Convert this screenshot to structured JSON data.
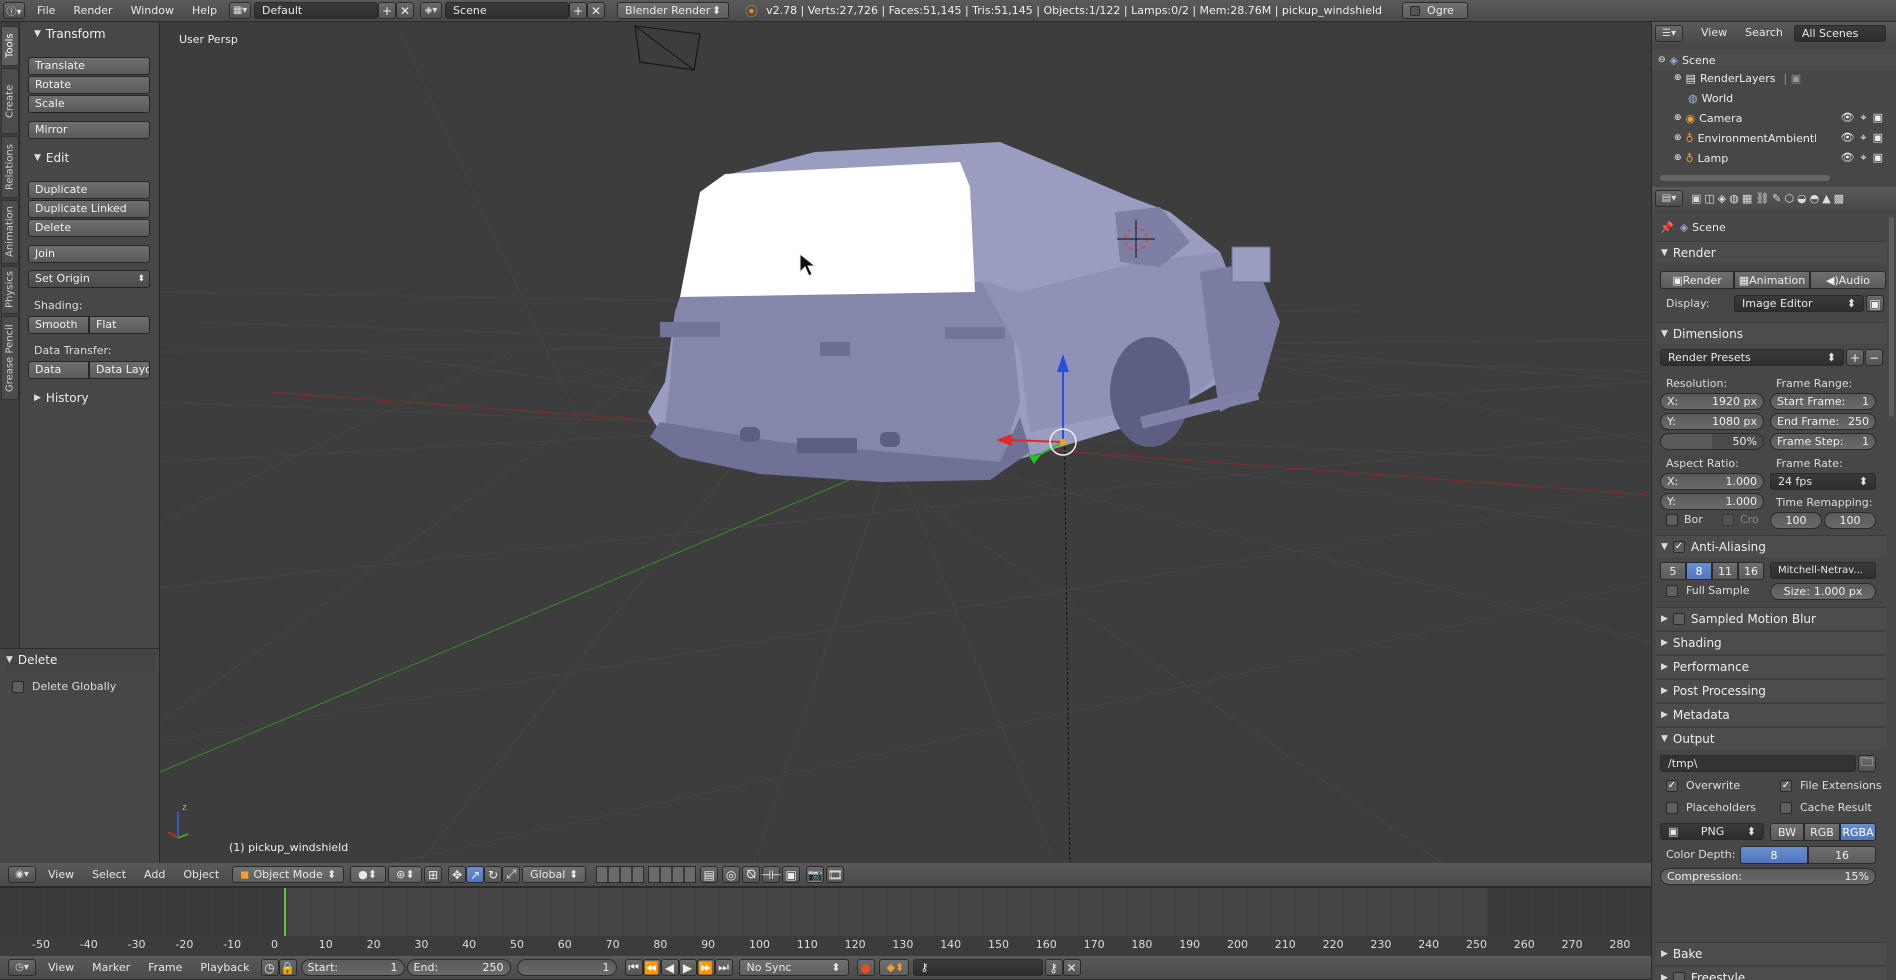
{
  "topbar": {
    "menus": [
      "File",
      "Render",
      "Window",
      "Help"
    ],
    "layout": "Default",
    "scene": "Scene",
    "engine": "Blender Render",
    "stats": "v2.78 | Verts:27,726 | Faces:51,145 | Tris:51,145 | Objects:1/122 | Lamps:0/2 | Mem:28.76M | pickup_windshield",
    "ogre": "Ogre"
  },
  "toolshelf": {
    "tabs": [
      "Tools",
      "Create",
      "Relations",
      "Animation",
      "Physics",
      "Grease Pencil"
    ],
    "transform": {
      "title": "Transform",
      "translate": "Translate",
      "rotate": "Rotate",
      "scale": "Scale",
      "mirror": "Mirror"
    },
    "edit": {
      "title": "Edit",
      "duplicate": "Duplicate",
      "duplicate_linked": "Duplicate Linked",
      "delete": "Delete",
      "join": "Join",
      "set_origin": "Set Origin",
      "shading_label": "Shading:",
      "smooth": "Smooth",
      "flat": "Flat",
      "data_transfer_label": "Data Transfer:",
      "data": "Data",
      "data_layout": "Data Layo"
    },
    "history": "History",
    "operator": {
      "title": "Delete",
      "delete_globally": "Delete Globally"
    }
  },
  "viewport": {
    "view_label": "User Persp",
    "object_label": "(1) pickup_windshield"
  },
  "outliner": {
    "buttons": [
      "View",
      "Search",
      "All Scenes"
    ],
    "items": [
      {
        "label": "Scene"
      },
      {
        "label": "RenderLayers"
      },
      {
        "label": "World"
      },
      {
        "label": "Camera"
      },
      {
        "label": "EnvironmentAmbientLi"
      },
      {
        "label": "Lamp"
      }
    ]
  },
  "properties": {
    "breadcrumb": "Scene",
    "render_section": "Render",
    "render_btn": "Render",
    "animation_btn": "Animation",
    "audio_btn": "Audio",
    "display_label": "Display:",
    "display_value": "Image Editor",
    "dimensions": "Dimensions",
    "render_presets": "Render Presets",
    "resolution_label": "Resolution:",
    "res_x_label": "X:",
    "res_x": "1920 px",
    "res_y_label": "Y:",
    "res_y": "1080 px",
    "res_pct": "50%",
    "frame_range_label": "Frame Range:",
    "start_frame_label": "Start Frame:",
    "start_frame": "1",
    "end_frame_label": "End Frame:",
    "end_frame": "250",
    "frame_step_label": "Frame Step:",
    "frame_step": "1",
    "aspect_label": "Aspect Ratio:",
    "aspect_x_label": "X:",
    "aspect_x": "1.000",
    "aspect_y_label": "Y:",
    "aspect_y": "1.000",
    "frame_rate_label": "Frame Rate:",
    "frame_rate": "24 fps",
    "time_remap_label": "Time Remapping:",
    "remap_old": "100",
    "remap_new": "100",
    "bor": "Bor",
    "cro": "Cro",
    "anti_aliasing": "Anti-Aliasing",
    "aa_samples": [
      "5",
      "8",
      "11",
      "16"
    ],
    "aa_filter": "Mitchell-Netrav...",
    "full_sample": "Full Sample",
    "aa_size_label": "Size:",
    "aa_size": "1.000 px",
    "sampled_motion_blur": "Sampled Motion Blur",
    "shading": "Shading",
    "performance": "Performance",
    "post_processing": "Post Processing",
    "metadata": "Metadata",
    "output": "Output",
    "output_path": "/tmp\\",
    "overwrite": "Overwrite",
    "file_extensions": "File Extensions",
    "placeholders": "Placeholders",
    "cache_result": "Cache Result",
    "file_format": "PNG",
    "color_modes": [
      "BW",
      "RGB",
      "RGBA"
    ],
    "color_depth_label": "Color Depth:",
    "color_depths": [
      "8",
      "16"
    ],
    "compression_label": "Compression:",
    "compression": "15%",
    "bake": "Bake",
    "freestyle": "Freestyle"
  },
  "viewheader": {
    "menus": [
      "View",
      "Select",
      "Add",
      "Object"
    ],
    "mode": "Object Mode",
    "orientation": "Global"
  },
  "timeline": {
    "ruler": [
      "-50",
      "-40",
      "-30",
      "-20",
      "-10",
      "0",
      "10",
      "20",
      "30",
      "40",
      "50",
      "60",
      "70",
      "80",
      "90",
      "100",
      "110",
      "120",
      "130",
      "140",
      "150",
      "160",
      "170",
      "180",
      "190",
      "200",
      "210",
      "220",
      "230",
      "240",
      "250",
      "260",
      "270",
      "280"
    ],
    "current_frame": "0"
  },
  "timeline_header": {
    "menus": [
      "View",
      "Marker",
      "Frame",
      "Playback"
    ],
    "start_label": "Start:",
    "start": "1",
    "end_label": "End:",
    "end": "250",
    "current": "1",
    "sync": "No Sync"
  },
  "colors": {
    "accent": "#5275bd",
    "selected": "#f0a030",
    "axis_x": "#c83232",
    "axis_y": "#32b432",
    "axis_z": "#3264e6"
  }
}
